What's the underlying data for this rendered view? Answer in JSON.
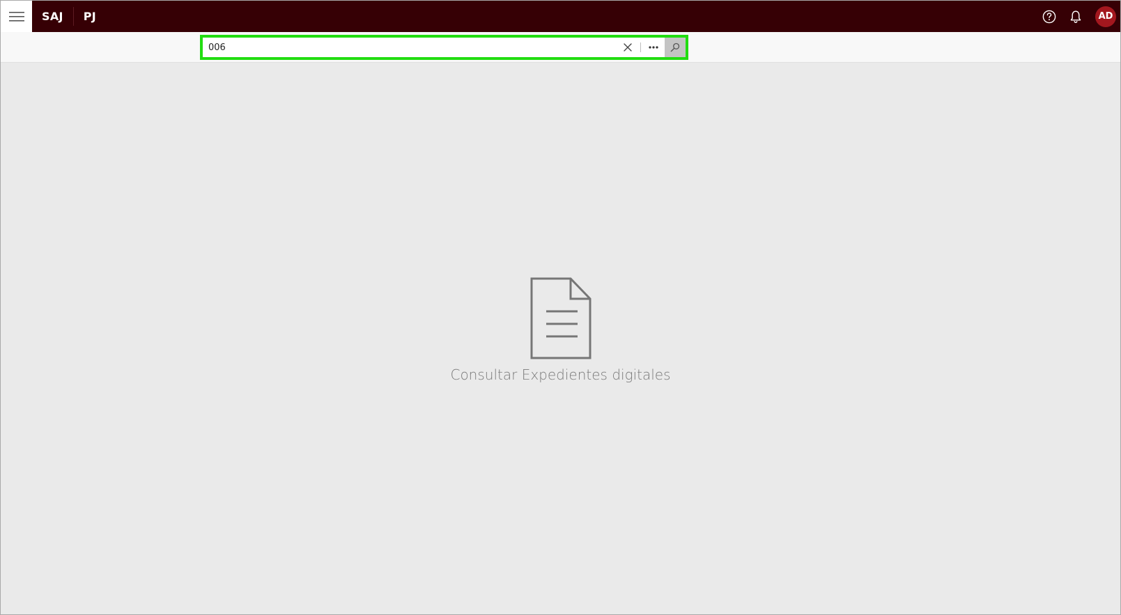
{
  "header": {
    "brand_primary": "SAJ",
    "brand_secondary": "PJ",
    "avatar_initials": "AD",
    "icons": [
      "hamburger-menu-icon",
      "help-icon",
      "bell-icon"
    ]
  },
  "search": {
    "value": "006"
  },
  "empty_state": {
    "icon": "document-icon",
    "title": "Consultar Expedientes digitales"
  },
  "colors": {
    "topbar": "#360005",
    "avatar": "#a3171e",
    "search_highlight": "#22dd11",
    "background": "#eaeaea"
  }
}
